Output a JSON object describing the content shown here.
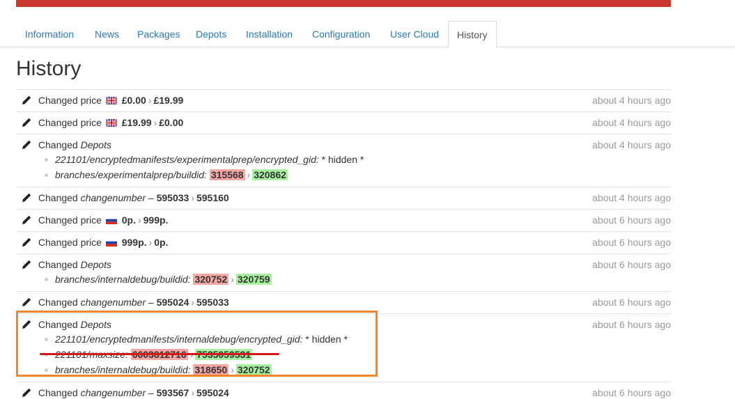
{
  "tabs": [
    {
      "label": "Information"
    },
    {
      "label": "News"
    },
    {
      "label": "Packages"
    },
    {
      "label": "Depots"
    },
    {
      "label": "Installation"
    },
    {
      "label": "Configuration"
    },
    {
      "label": "User Cloud"
    },
    {
      "label": "History",
      "active": true
    }
  ],
  "page_title": "History",
  "colors": {
    "accent_bar": "#c9382d",
    "link": "#2a7ab0",
    "removed": "#f4a7a3",
    "added": "#a7f0a0",
    "highlight_box": "#f5852a",
    "underline": "#d3181b"
  },
  "rows": [
    {
      "action": "Changed price",
      "flag": "uk-flag-icon",
      "old": "£0.00",
      "arrow": "›",
      "new": "£19.99",
      "time": "about 4 hours ago"
    },
    {
      "action": "Changed price",
      "flag": "uk-flag-icon",
      "old": "£19.99",
      "arrow": "›",
      "new": "£0.00",
      "time": "about 4 hours ago"
    },
    {
      "action": "Changed",
      "target": "Depots",
      "time": "about 4 hours ago",
      "items": [
        {
          "key": "221101/encryptedmanifests/experimentalprep/encrypted_gid:",
          "value": "* hidden *"
        },
        {
          "key": "branches/experimentalprep/buildid:",
          "old": "315568",
          "new": "320862"
        }
      ]
    },
    {
      "action": "Changed",
      "target": "changenumber",
      "dash": "–",
      "old": "595033",
      "new": "595160",
      "time": "about 4 hours ago"
    },
    {
      "action": "Changed price",
      "flag": "ru-flag-icon",
      "old": "0р.",
      "new": "999р.",
      "time": "about 6 hours ago"
    },
    {
      "action": "Changed price",
      "flag": "ru-flag-icon",
      "old": "999р.",
      "new": "0р.",
      "time": "about 6 hours ago"
    },
    {
      "action": "Changed",
      "target": "Depots",
      "time": "about 6 hours ago",
      "items": [
        {
          "key": "branches/internaldebug/buildid:",
          "old": "320752",
          "new": "320759"
        }
      ]
    },
    {
      "action": "Changed",
      "target": "changenumber",
      "dash": "–",
      "old": "595024",
      "new": "595033",
      "time": "about 6 hours ago"
    },
    {
      "action": "Changed",
      "target": "Depots",
      "time": "about 6 hours ago",
      "items": [
        {
          "key": "221101/encryptedmanifests/internaldebug/encrypted_gid:",
          "value": "* hidden *"
        },
        {
          "key": "221101/maxsize:",
          "old": "6603812716",
          "new": "7535059531"
        },
        {
          "key": "branches/internaldebug/buildid:",
          "old": "318650",
          "new": "320752"
        }
      ]
    },
    {
      "action": "Changed",
      "target": "changenumber",
      "dash": "–",
      "old": "593567",
      "new": "595024",
      "time": "about 6 hours ago"
    }
  ]
}
